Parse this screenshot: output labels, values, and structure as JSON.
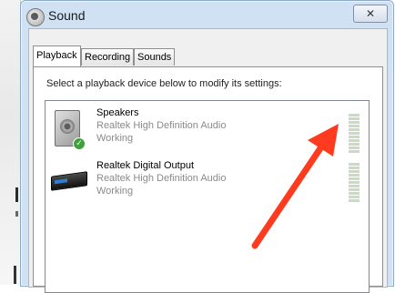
{
  "window": {
    "title": "Sound",
    "close_glyph": "✕"
  },
  "tabs": [
    {
      "label": "Playback",
      "active": true
    },
    {
      "label": "Recording",
      "active": false
    },
    {
      "label": "Sounds",
      "active": false
    }
  ],
  "playback": {
    "instruction": "Select a playback device below to modify its settings:",
    "devices": [
      {
        "name": "Speakers",
        "description": "Realtek High Definition Audio",
        "status": "Working",
        "icon": "speaker-icon",
        "default": true
      },
      {
        "name": "Realtek Digital Output",
        "description": "Realtek High Definition Audio",
        "status": "Working",
        "icon": "digital-output-icon",
        "default": false
      }
    ]
  },
  "annotation": {
    "arrow_color": "#ff3b1f",
    "points_to": "speakers-level-meter"
  },
  "colors": {
    "title_bar": "#cfe1f3",
    "meter_bar": "#cdd9c7"
  }
}
